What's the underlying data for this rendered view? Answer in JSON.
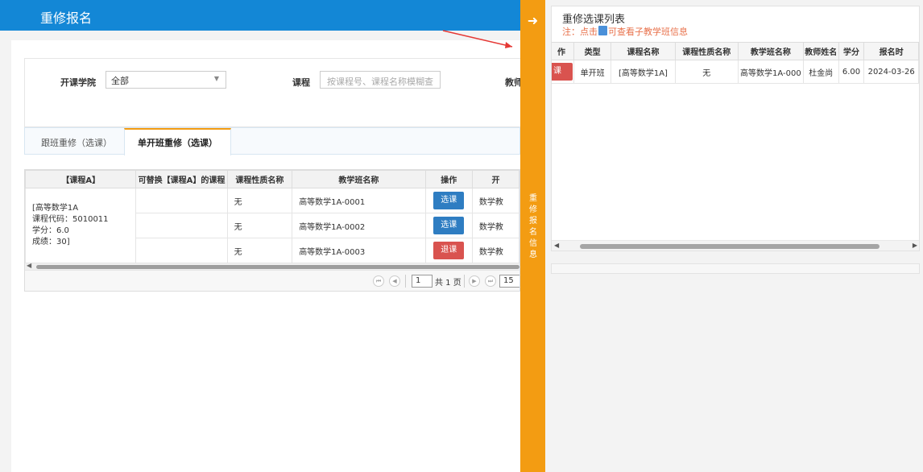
{
  "header": {
    "title": "重修报名"
  },
  "filters": {
    "college_label": "开课学院",
    "college_value": "全部",
    "course_label": "课程",
    "course_placeholder": "按课程号、课程名称模糊查",
    "teacher_label": "教师"
  },
  "tabs": [
    {
      "label": "跟班重修（选课）",
      "active": false
    },
    {
      "label": "单开班重修（选课）",
      "active": true
    }
  ],
  "table": {
    "headers": [
      "【课程A】",
      "可替换【课程A】的课程",
      "课程性质名称",
      "教学班名称",
      "操作",
      "开"
    ],
    "course_info": {
      "name": "[高等数学1A",
      "code": "课程代码：5010011",
      "credit": "学分：6.0",
      "score": "成绩：30]"
    },
    "rows": [
      {
        "nature": "无",
        "class": "高等数学1A-0001",
        "action": "选课",
        "action_type": "select",
        "extra": "数学教"
      },
      {
        "nature": "无",
        "class": "高等数学1A-0002",
        "action": "选课",
        "action_type": "select",
        "extra": "数学教"
      },
      {
        "nature": "无",
        "class": "高等数学1A-0003",
        "action": "退课",
        "action_type": "drop",
        "extra": "数学教"
      }
    ]
  },
  "pager": {
    "page": "1",
    "total_text": "共 1 页",
    "page_size": "15"
  },
  "sidebar": {
    "text": "重修报名信息"
  },
  "right_panel": {
    "title": "重修选课列表",
    "note_before": "注：点击",
    "note_after": "可查看子教学班信息",
    "headers": [
      "作",
      "类型",
      "课程名称",
      "课程性质名称",
      "教学班名称",
      "教师姓名",
      "学分",
      "报名时"
    ],
    "rows": [
      {
        "action": "课",
        "type": "单开班",
        "course": "[高等数学1A]",
        "nature": "无",
        "class": "高等数学1A-000",
        "teacher": "杜金尚",
        "credit": "6.00",
        "date": "2024-03-26"
      }
    ]
  },
  "colors": {
    "header_blue": "#1387d6",
    "orange": "#f39c12",
    "btn_blue": "#2e7dc2",
    "btn_red": "#d9534f",
    "link": "#2a73c7",
    "note": "#e8704a"
  }
}
